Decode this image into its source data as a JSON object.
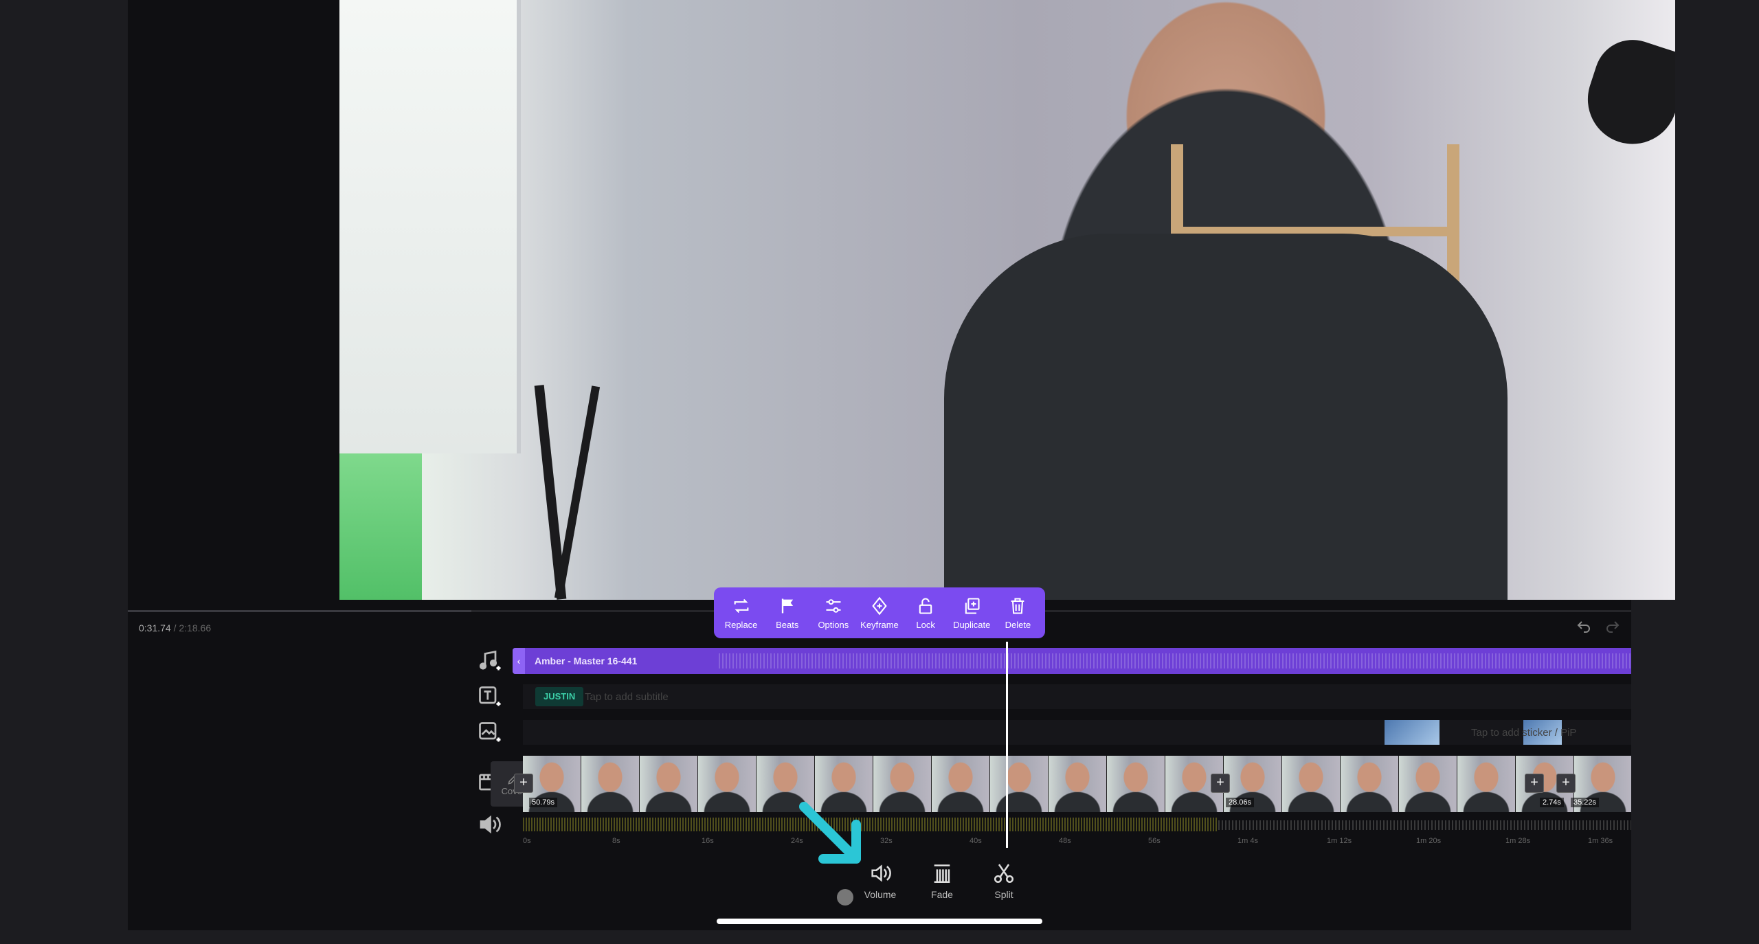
{
  "playback": {
    "current_time": "0:31.74",
    "separator": " / ",
    "total_time": "2:18.66"
  },
  "clip_toolbar": {
    "items": [
      {
        "label": "Replace",
        "icon": "replace-icon"
      },
      {
        "label": "Beats",
        "icon": "flag-icon"
      },
      {
        "label": "Options",
        "icon": "sliders-icon"
      },
      {
        "label": "Keyframe",
        "icon": "keyframe-icon"
      },
      {
        "label": "Lock",
        "icon": "lock-icon"
      },
      {
        "label": "Duplicate",
        "icon": "duplicate-icon"
      },
      {
        "label": "Delete",
        "icon": "trash-icon"
      }
    ]
  },
  "tracks": {
    "music": {
      "title": "Amber - Master 16-441",
      "handle": "‹"
    },
    "subtitle": {
      "chip": "JUSTIN",
      "hint": "Tap to add subtitle"
    },
    "pip": {
      "hint": "Tap to add sticker / PiP"
    },
    "video": {
      "split_marks": [
        "+",
        "+",
        "+",
        "+"
      ],
      "durations": [
        "50.79s",
        "28.06s",
        "2.74s",
        "35.22s"
      ]
    }
  },
  "ruler": [
    "0s",
    "8s",
    "16s",
    "24s",
    "32s",
    "40s",
    "48s",
    "56s",
    "1m 4s",
    "1m 12s",
    "1m 20s",
    "1m 28s",
    "1m 36s"
  ],
  "cover": {
    "label": "Cover"
  },
  "bottom_tools": [
    {
      "label": "Volume",
      "icon": "volume-icon"
    },
    {
      "label": "Fade",
      "icon": "fade-icon"
    },
    {
      "label": "Split",
      "icon": "scissors-icon"
    }
  ],
  "colors": {
    "accent": "#7b4bf0",
    "music_track": "#6d3fd6",
    "subtitle_chip": "#3ccfa8",
    "annotation_arrow": "#2bc6d6"
  }
}
